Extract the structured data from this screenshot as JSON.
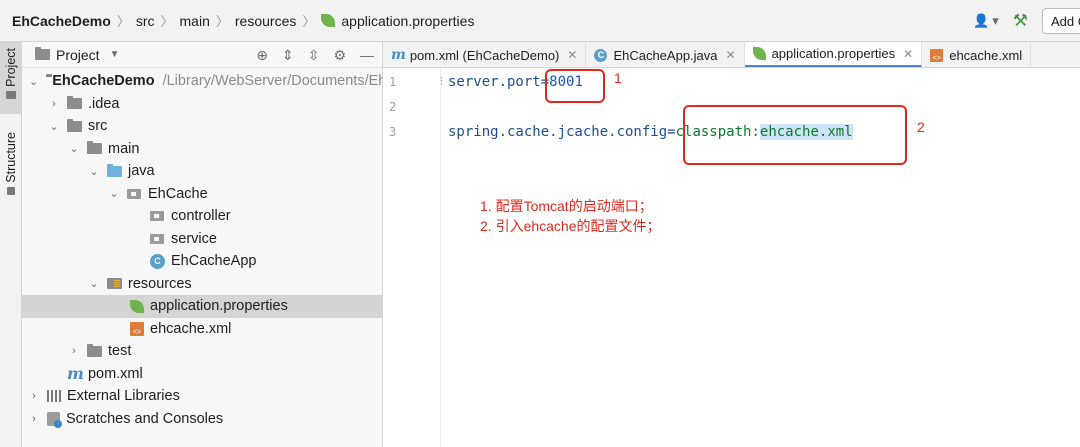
{
  "breadcrumb": [
    "EhCacheDemo",
    "src",
    "main",
    "resources",
    "application.properties"
  ],
  "top_right": {
    "add_label": "Add Configuration"
  },
  "side_tabs": [
    "Project",
    "Structure"
  ],
  "project_panel": {
    "title": "Project",
    "tree": [
      {
        "label": "EhCacheDemo",
        "path": "/Library/WebServer/Documents/EhCacheDemo"
      },
      {
        "label": ".idea"
      },
      {
        "label": "src"
      },
      {
        "label": "main"
      },
      {
        "label": "java"
      },
      {
        "label": "EhCache"
      },
      {
        "label": "controller"
      },
      {
        "label": "service"
      },
      {
        "label": "EhCacheApp"
      },
      {
        "label": "resources"
      },
      {
        "label": "application.properties"
      },
      {
        "label": "ehcache.xml"
      },
      {
        "label": "test"
      },
      {
        "label": "pom.xml"
      },
      {
        "label": "External Libraries"
      },
      {
        "label": "Scratches and Consoles"
      }
    ]
  },
  "tabs": [
    {
      "label": "pom.xml (EhCacheDemo)"
    },
    {
      "label": "EhCacheApp.java"
    },
    {
      "label": "application.properties"
    },
    {
      "label": "ehcache.xml"
    }
  ],
  "editor": {
    "line_numbers": [
      "1",
      "2",
      "3"
    ],
    "line1": {
      "key": "server.port",
      "eq": "=",
      "value": "8001"
    },
    "line3": {
      "key": "spring.cache.jcache.config",
      "eq": "=",
      "value_prefix": "classpath:",
      "value_file": "ehcache.xml"
    }
  },
  "annotations": {
    "callout1": "1",
    "callout2": "2",
    "notes": [
      "1.  配置Tomcat的启动端口；",
      "2. 引入ehcache的配置文件；"
    ]
  },
  "colors": {
    "annotation_red": "#e0291e",
    "accent_blue": "#4a88c7",
    "selection": "#d4d4d4"
  }
}
